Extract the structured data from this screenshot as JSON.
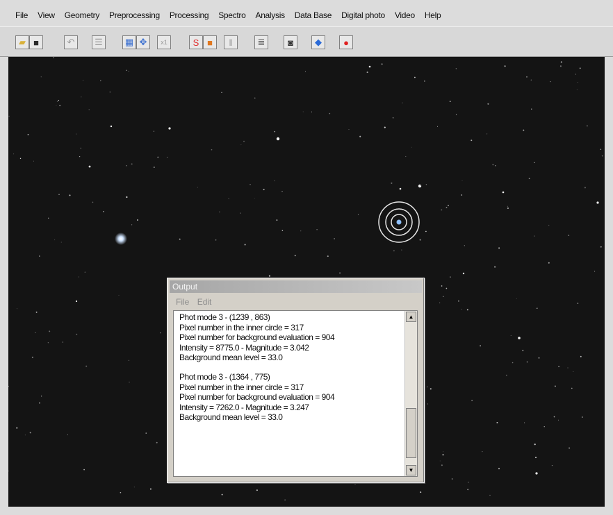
{
  "menubar": {
    "items": [
      "File",
      "View",
      "Geometry",
      "Preprocessing",
      "Processing",
      "Spectro",
      "Analysis",
      "Data Base",
      "Digital photo",
      "Video",
      "Help"
    ]
  },
  "toolbar": {
    "buttons": [
      {
        "name": "open-icon",
        "color": "#d9b13a"
      },
      {
        "name": "save-icon",
        "color": "#2a2a2a"
      },
      {
        "name": "undo-icon",
        "color": "#9a9a9a"
      },
      {
        "name": "settings-icon",
        "color": "#9a9a9a"
      },
      {
        "name": "grid-icon",
        "color": "#3a6fd0"
      },
      {
        "name": "move-icon",
        "color": "#3a6fd0"
      },
      {
        "name": "scale-icon",
        "color": "#9a9a9a"
      },
      {
        "name": "spectro-icon",
        "color": "#e03030"
      },
      {
        "name": "frame-icon",
        "color": "#e07820"
      },
      {
        "name": "pause-icon",
        "color": "#9a9a9a"
      },
      {
        "name": "list-icon",
        "color": "#555555"
      },
      {
        "name": "camera-icon",
        "color": "#333333"
      },
      {
        "name": "diamond-icon",
        "color": "#2a6ad8"
      },
      {
        "name": "record-icon",
        "color": "#e02020"
      }
    ]
  },
  "output_window": {
    "title": "Output",
    "menu": [
      "File",
      "Edit"
    ],
    "lines": [
      "Phot mode 3 - (1239 , 863)",
      "Pixel number in the inner circle = 317",
      "Pixel number for background evaluation = 904",
      "Intensity = 8775.0 - Magnitude = 3.042",
      "Background mean level = 33.0",
      "",
      "Phot mode 3 - (1364 , 775)",
      "Pixel number in the inner circle = 317",
      "Pixel number for background evaluation = 904",
      "Intensity = 7262.0 - Magnitude = 3.247",
      "Background mean level = 33.0"
    ]
  },
  "colors": {
    "sky": "#141414",
    "aperture_ring": "#e8e8e8",
    "bright_star": "#cfe4ff"
  }
}
